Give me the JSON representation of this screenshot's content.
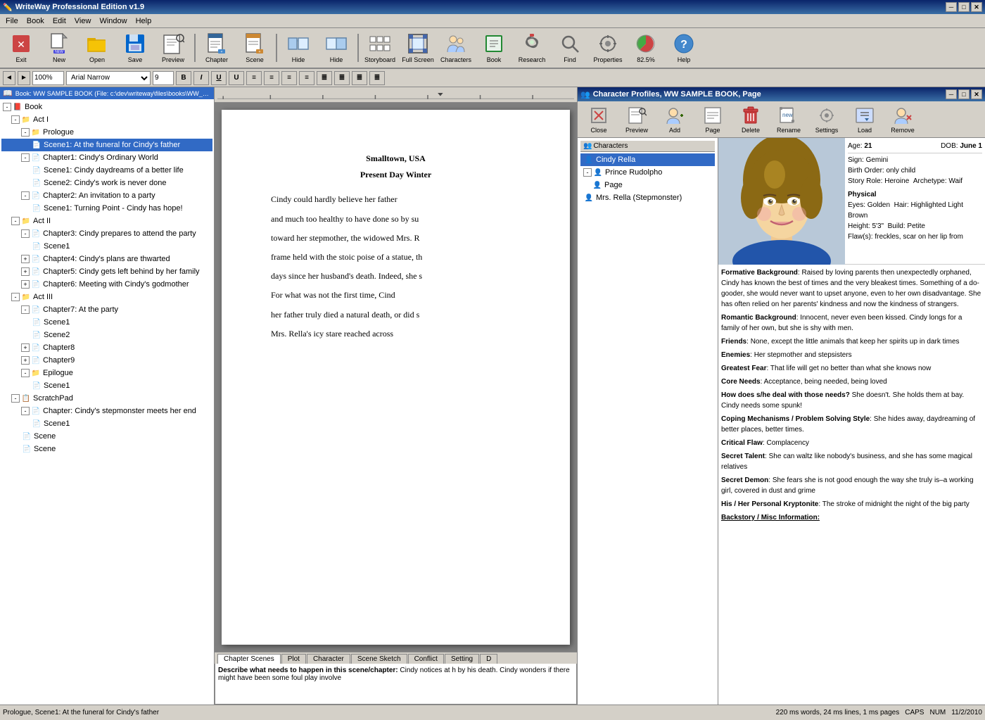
{
  "app": {
    "title": "WriteWay Professional Edition v1.9",
    "title_icon": "✏️"
  },
  "title_bar": {
    "title": "WriteWay Professional Edition v1.9",
    "minimize": "─",
    "maximize": "□",
    "close": "✕"
  },
  "menu": {
    "items": [
      "File",
      "Book",
      "Edit",
      "View",
      "Window",
      "Help"
    ]
  },
  "toolbar": {
    "buttons": [
      {
        "id": "exit",
        "label": "Exit",
        "icon": "🚪"
      },
      {
        "id": "new",
        "label": "New",
        "icon": "📄"
      },
      {
        "id": "open",
        "label": "Open",
        "icon": "📂"
      },
      {
        "id": "save",
        "label": "Save",
        "icon": "💾"
      },
      {
        "id": "preview",
        "label": "Preview",
        "icon": "👁"
      },
      {
        "id": "chapter",
        "label": "Chapter",
        "icon": "📖"
      },
      {
        "id": "scene",
        "label": "Scene",
        "icon": "🎭"
      },
      {
        "id": "hide1",
        "label": "Hide",
        "icon": "🙈"
      },
      {
        "id": "hide2",
        "label": "Hide",
        "icon": "👁‍🗨"
      },
      {
        "id": "storyboard",
        "label": "Storyboard",
        "icon": "🎬"
      },
      {
        "id": "fullscreen",
        "label": "Full Screen",
        "icon": "⛶"
      },
      {
        "id": "characters",
        "label": "Characters",
        "icon": "👥"
      },
      {
        "id": "book",
        "label": "Book",
        "icon": "📗"
      },
      {
        "id": "research",
        "label": "Research",
        "icon": "🔭"
      },
      {
        "id": "find",
        "label": "Find",
        "icon": "🔍"
      },
      {
        "id": "properties",
        "label": "Properties",
        "icon": "⚙"
      },
      {
        "id": "pie",
        "label": "82.5%",
        "icon": "🥧"
      },
      {
        "id": "help",
        "label": "Help",
        "icon": "❓"
      }
    ]
  },
  "format_bar": {
    "zoom": "100%",
    "font": "Arial Narrow",
    "size": "9"
  },
  "book_panel": {
    "title": "Book: WW SAMPLE BOOK (File: c:\\dev\\writeway\\files\\books\\WW_Sample_Book.wwb)",
    "tree": [
      {
        "id": "book",
        "label": "Book",
        "level": 0,
        "type": "book",
        "expanded": true
      },
      {
        "id": "act1",
        "label": "Act I",
        "level": 1,
        "type": "act",
        "expanded": true
      },
      {
        "id": "prologue",
        "label": "Prologue",
        "level": 2,
        "type": "folder",
        "expanded": true
      },
      {
        "id": "scene_funeral",
        "label": "Scene1: At the funeral for Cindy's father",
        "level": 3,
        "type": "scene",
        "selected": true
      },
      {
        "id": "ch1",
        "label": "Chapter1: Cindy's Ordinary World",
        "level": 2,
        "type": "chapter",
        "expanded": true
      },
      {
        "id": "ch1s1",
        "label": "Scene1: Cindy daydreams of a better life",
        "level": 3,
        "type": "scene_red"
      },
      {
        "id": "ch1s2",
        "label": "Scene2: Cindy's work is never done",
        "level": 3,
        "type": "scene"
      },
      {
        "id": "ch2",
        "label": "Chapter2: An invitation to a party",
        "level": 2,
        "type": "chapter",
        "expanded": true
      },
      {
        "id": "ch2s1",
        "label": "Scene1: Turning Point - Cindy has hope!",
        "level": 3,
        "type": "scene_green"
      },
      {
        "id": "act2",
        "label": "Act II",
        "level": 1,
        "type": "act",
        "expanded": true
      },
      {
        "id": "ch3",
        "label": "Chapter3: Cindy prepares to attend the party",
        "level": 2,
        "type": "chapter",
        "expanded": true
      },
      {
        "id": "ch3s1",
        "label": "Scene1",
        "level": 3,
        "type": "scene"
      },
      {
        "id": "ch4",
        "label": "Chapter4: Cindy's plans are thwarted",
        "level": 2,
        "type": "chapter"
      },
      {
        "id": "ch5",
        "label": "Chapter5: Cindy gets left behind by her family",
        "level": 2,
        "type": "chapter"
      },
      {
        "id": "ch6",
        "label": "Chapter6: Meeting with Cindy's godmother",
        "level": 2,
        "type": "chapter"
      },
      {
        "id": "act3",
        "label": "Act III",
        "level": 1,
        "type": "act",
        "expanded": true
      },
      {
        "id": "ch7",
        "label": "Chapter7: At the party",
        "level": 2,
        "type": "chapter",
        "expanded": true
      },
      {
        "id": "ch7s1",
        "label": "Scene1",
        "level": 3,
        "type": "scene"
      },
      {
        "id": "ch7s2",
        "label": "Scene2",
        "level": 3,
        "type": "scene_red"
      },
      {
        "id": "ch8",
        "label": "Chapter8",
        "level": 2,
        "type": "chapter"
      },
      {
        "id": "ch9",
        "label": "Chapter9",
        "level": 2,
        "type": "chapter"
      },
      {
        "id": "epilogue",
        "label": "Epilogue",
        "level": 2,
        "type": "folder",
        "expanded": true
      },
      {
        "id": "eps1",
        "label": "Scene1",
        "level": 3,
        "type": "scene"
      },
      {
        "id": "scratch",
        "label": "ScratchPad",
        "level": 1,
        "type": "scratch",
        "expanded": true
      },
      {
        "id": "scr_ch",
        "label": "Chapter: Cindy's stepmonster meets her end",
        "level": 2,
        "type": "chapter",
        "expanded": true
      },
      {
        "id": "scr_s1",
        "label": "Scene1",
        "level": 3,
        "type": "scene"
      },
      {
        "id": "scr_scene1",
        "label": "Scene",
        "level": 2,
        "type": "scene"
      },
      {
        "id": "scr_scene2",
        "label": "Scene",
        "level": 2,
        "type": "scene"
      }
    ]
  },
  "document": {
    "location": "Smalltown, USA",
    "time": "Present Day Winter",
    "paragraphs": [
      "Cindy could hardly believe her father",
      "and much too healthy to have done so by su",
      "toward her stepmother, the widowed Mrs. R",
      "frame held with the stoic poise of a statue, th",
      "days since her husband's death. Indeed, she s",
      "For what was not the first time, Cind",
      "her father truly died a natural death, or did s",
      "Mrs. Rella's icy stare reached across"
    ]
  },
  "bottom_tabs": {
    "tabs": [
      "Chapter Scenes",
      "Plot",
      "Character",
      "Scene Sketch",
      "Conflict",
      "Setting",
      "D"
    ],
    "active": "Chapter Scenes",
    "content": "Describe what needs to happen in this scene/chapter: Cindy notices at h by his death. Cindy wonders if there might have been some foul play involve"
  },
  "char_panel": {
    "title": "Character Profiles, WW SAMPLE BOOK, Page",
    "toolbar_buttons": [
      "Close",
      "Preview",
      "Add",
      "Page",
      "Delete",
      "Rename",
      "Settings",
      "Load",
      "Remove"
    ],
    "tree": {
      "title": "Characters",
      "items": [
        {
          "label": "Cindy Rella",
          "selected": true,
          "level": 0
        },
        {
          "label": "Prince Rudolpho",
          "level": 0,
          "expanded": true
        },
        {
          "label": "Page",
          "level": 1
        },
        {
          "label": "Mrs. Rella (Stepmonster)",
          "level": 0
        }
      ]
    },
    "character": {
      "name": "Cindy Rella",
      "photo_alt": "Cindy Rella photo",
      "age": "21",
      "dob": "June 1",
      "sign": "Gemini",
      "birth_order": "only child",
      "story_role": "Heroine",
      "archetype": "Waif",
      "physical_label": "Physical",
      "eyes": "Golden",
      "hair": "Highlighted Light Brown",
      "height": "5'3\"",
      "build": "Petite",
      "flaws": "freckles, scar on her lip from",
      "formative_bg": "Raised by loving parents then unexpectedly orphaned, Cindy has known the best of times and the very bleakest times. Something of a do-gooder, she would never want to upset anyone, even to her own disadvantage. She has often relied on her parents' kindness and now the kindness of strangers.",
      "romantic_bg": "Innocent, never even been kissed. Cindy longs for a family of her own, but she is shy with men.",
      "friends": "None, except the little animals that keep her spirits up in dark times",
      "enemies": "Her stepmother and stepsisters",
      "greatest_fear": "That life will get no better than what she knows now",
      "core_needs": "Acceptance, being needed, being loved",
      "how_deal": "She doesn't. She holds them at bay. Cindy needs some spunk!",
      "coping": "She hides away, daydreaming of better places, better times.",
      "critical_flaw": "Complacency",
      "secret_talent": "She can waltz like nobody's business, and she has some magical relatives",
      "secret_demon": "She fears she is not good enough the way she truly is–a working girl, covered in dust and grime",
      "kryptonite": "The stroke of midnight the night of the big party",
      "backstory": "Backstory / Misc Information:"
    }
  },
  "status_bar": {
    "location": "Prologue, Scene1: At the funeral for Cindy's father",
    "stats": "220 ms words, 24 ms lines, 1 ms pages",
    "caps": "CAPS",
    "num": "NUM",
    "date": "11/2/2010"
  }
}
